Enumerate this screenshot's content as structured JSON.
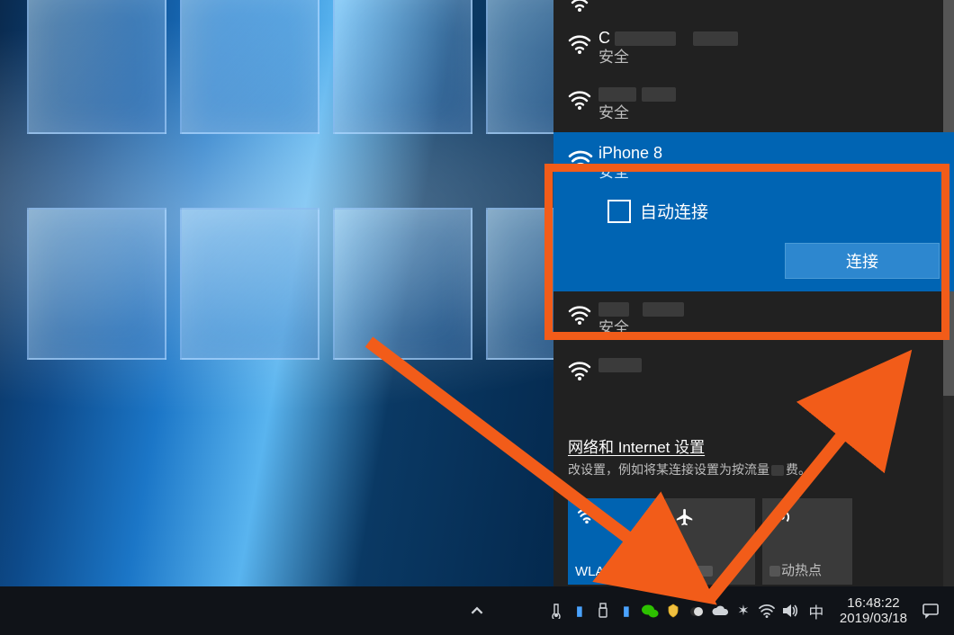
{
  "wifi_panel": {
    "networks": [
      {
        "name_obscured": true,
        "security": "安全"
      },
      {
        "name_obscured": true,
        "security": "安全"
      }
    ],
    "selected": {
      "name": "iPhone 8",
      "security": "安全",
      "auto_connect_label": "自动连接",
      "auto_connect_checked": false,
      "connect_button": "连接"
    },
    "below": [
      {
        "name_obscured": true,
        "security": "安全"
      },
      {
        "name_obscured": true
      }
    ],
    "settings_title": "网络和 Internet 设置",
    "settings_subtitle_prefix": "改设置，例如将某连接设置为按流量",
    "settings_subtitle_suffix": "费。",
    "tiles": {
      "wlan": {
        "label": "WLAN",
        "active": true
      },
      "airplane": {
        "label_prefix": "飞",
        "label_hidden": true
      },
      "hotspot": {
        "label_suffix": "动热点"
      }
    }
  },
  "taskbar": {
    "ime": "中",
    "time": "16:48:22",
    "date": "2019/03/18"
  }
}
